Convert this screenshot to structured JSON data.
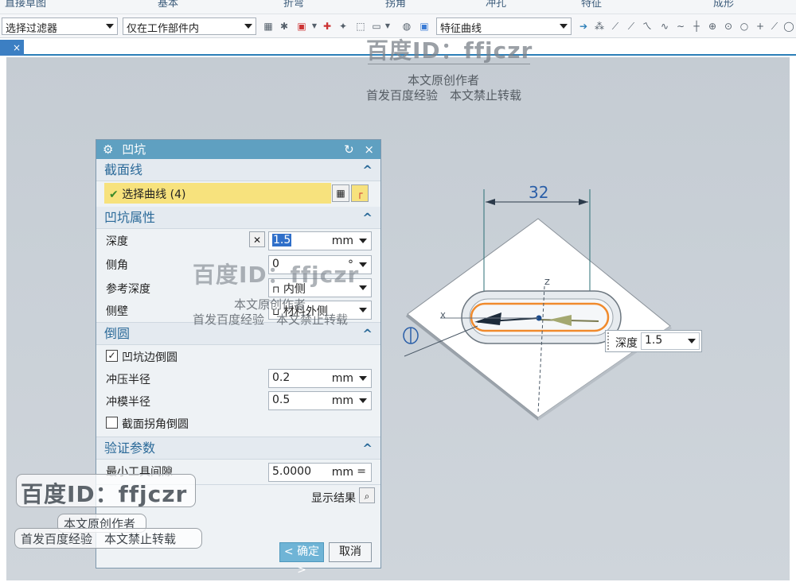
{
  "ribbon_tabs": [
    "直接草图",
    "基本",
    "折弯",
    "拐角",
    "冲孔",
    "特征",
    "成形"
  ],
  "toolbar": {
    "filter_combo": "选择过滤器",
    "scope_combo": "仅在工作部件内",
    "curve_combo": "特征曲线"
  },
  "doc_tab": {
    "close": "×"
  },
  "dialog": {
    "title": "凹坑",
    "reset_icon": "↻",
    "close_icon": "×",
    "section_curve": {
      "header": "截面线",
      "select_label": "选择曲线 (4)"
    },
    "section_props": {
      "header": "凹坑属性",
      "depth_label": "深度",
      "depth_value": "1.5",
      "depth_unit": "mm",
      "angle_label": "侧角",
      "angle_value": "0",
      "angle_unit": "°",
      "ref_depth_label": "参考深度",
      "ref_depth_value": "内侧",
      "side_wall_label": "侧壁",
      "side_wall_value": "材料外侧"
    },
    "section_round": {
      "header": "倒圆",
      "edge_round_label": "凹坑边倒圆",
      "punch_radius_label": "冲压半径",
      "punch_radius_value": "0.2",
      "punch_radius_unit": "mm",
      "die_radius_label": "冲模半径",
      "die_radius_value": "0.5",
      "die_radius_unit": "mm",
      "corner_round_label": "截面拐角倒圆"
    },
    "section_verify": {
      "header": "验证参数",
      "min_radius_label": "最小工具间隙",
      "min_radius_value": "5.0000",
      "min_radius_unit": "mm",
      "min_radius_eq": "="
    },
    "show_result_label": "显示结果",
    "ok_label": "< 确定 >",
    "cancel_label": "取消"
  },
  "graphics": {
    "dimension_value": "32",
    "depth_label": "深度",
    "depth_value": "1.5"
  },
  "watermarks": {
    "id_text": "百度ID：ffjczr",
    "author_text": "本文原创作者",
    "notice_text": "首发百度经验　本文禁止转载"
  },
  "colors": {
    "dialog_title": "#5fa0c1",
    "section_header_text": "#2b6a99",
    "selection_highlight": "#f7e27d",
    "ok_button": "#6fb4d6",
    "viewport": "#c9d0d7"
  }
}
